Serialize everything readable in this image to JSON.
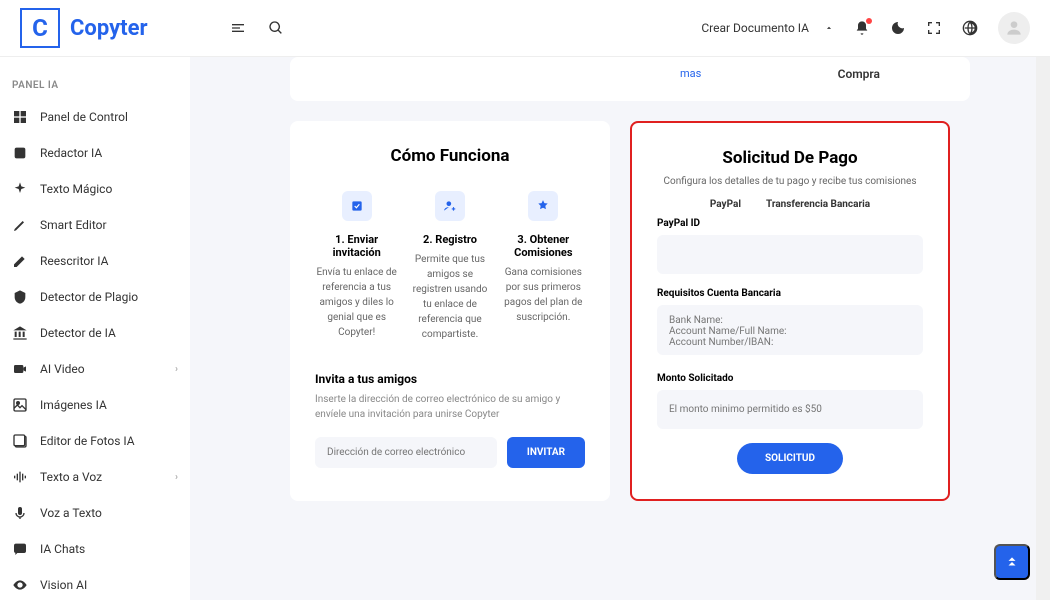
{
  "logo": {
    "letter": "C",
    "text": "Copyter"
  },
  "header": {
    "create_doc": "Crear Documento IA"
  },
  "sidebar": {
    "section": "PANEL IA",
    "items": [
      {
        "label": "Panel de Control",
        "icon": "dashboard",
        "expand": false
      },
      {
        "label": "Redactor IA",
        "icon": "ai",
        "expand": false
      },
      {
        "label": "Texto Mágico",
        "icon": "sparkle",
        "expand": false
      },
      {
        "label": "Smart Editor",
        "icon": "pen",
        "expand": false
      },
      {
        "label": "Reescritor IA",
        "icon": "edit",
        "expand": false
      },
      {
        "label": "Detector de Plagio",
        "icon": "shield",
        "expand": false
      },
      {
        "label": "Detector de IA",
        "icon": "bank",
        "expand": false
      },
      {
        "label": "AI Video",
        "icon": "video",
        "expand": true
      },
      {
        "label": "Imágenes IA",
        "icon": "image",
        "expand": false
      },
      {
        "label": "Editor de Fotos IA",
        "icon": "gallery",
        "expand": false
      },
      {
        "label": "Texto a Voz",
        "icon": "sound",
        "expand": true
      },
      {
        "label": "Voz a Texto",
        "icon": "mic",
        "expand": false
      },
      {
        "label": "IA Chats",
        "icon": "chat",
        "expand": false
      },
      {
        "label": "Vision AI",
        "icon": "eye",
        "expand": false
      }
    ]
  },
  "topcard": {
    "more": "mas",
    "buy": "Compra"
  },
  "how": {
    "title": "Cómo Funciona",
    "steps": [
      {
        "title": "1. Enviar invitación",
        "desc": "Envía tu enlace de referencia a tus amigos y diles lo genial que es Copyter!"
      },
      {
        "title": "2. Registro",
        "desc": "Permite que tus amigos se registren usando tu enlace de referencia que compartiste."
      },
      {
        "title": "3. Obtener Comisiones",
        "desc": "Gana comisiones por sus primeros pagos del plan de suscripción."
      }
    ],
    "invite_title": "Invita a tus amigos",
    "invite_desc": "Inserte la dirección de correo electrónico de su amigo y envíele una invitación para unirse Copyter",
    "invite_placeholder": "Dirección de correo electrónico",
    "invite_btn": "INVITAR"
  },
  "pay": {
    "title": "Solicitud De Pago",
    "sub": "Configura los detalles de tu pago y recibe tus comisiones",
    "tab_paypal": "PayPal",
    "tab_bank": "Transferencia Bancaria",
    "paypal_label": "PayPal ID",
    "bank_label": "Requisitos Cuenta Bancaria",
    "bank_placeholder": "Bank Name:\nAccount Name/Full Name:\nAccount Number/IBAN:",
    "amount_label": "Monto Solicitado",
    "amount_placeholder": "El monto minimo permitido es $50",
    "btn": "SOLICITUD"
  }
}
